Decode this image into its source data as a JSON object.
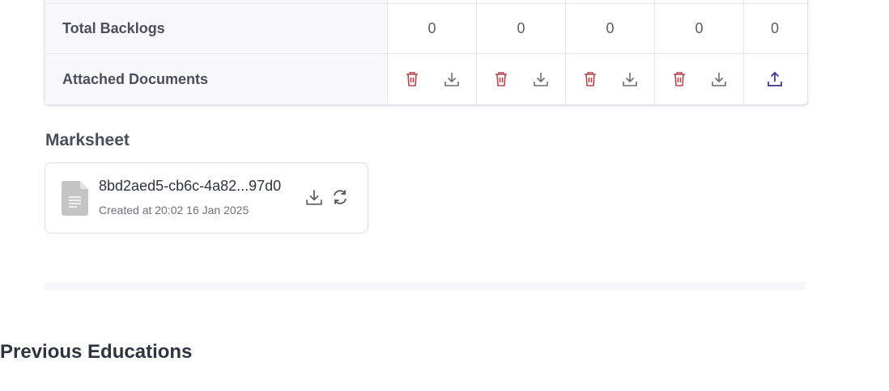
{
  "table": {
    "backlogs_label": "Total Backlogs",
    "backlogs_values": [
      "0",
      "0",
      "0",
      "0",
      "0"
    ],
    "documents_label": "Attached Documents",
    "document_cells": [
      {
        "delete": "trash-icon",
        "download": "download-icon"
      },
      {
        "delete": "trash-icon",
        "download": "download-icon"
      },
      {
        "delete": "trash-icon",
        "download": "download-icon"
      },
      {
        "delete": "trash-icon",
        "download": "download-icon"
      }
    ],
    "last_cell_icon": "upload-icon"
  },
  "marksheet": {
    "title": "Marksheet",
    "file_name": "8bd2aed5-cb6c-4a82...97d0",
    "created": "Created at 20:02 16 Jan 2025",
    "icons": [
      "file-icon",
      "download-icon",
      "refresh-icon"
    ]
  },
  "previous": {
    "title": "Previous Educations"
  },
  "colors": {
    "delete": "#b5474b",
    "download": "#6b6f7a",
    "upload": "#3b2f8f",
    "label_bg": "#f8f7fc"
  }
}
